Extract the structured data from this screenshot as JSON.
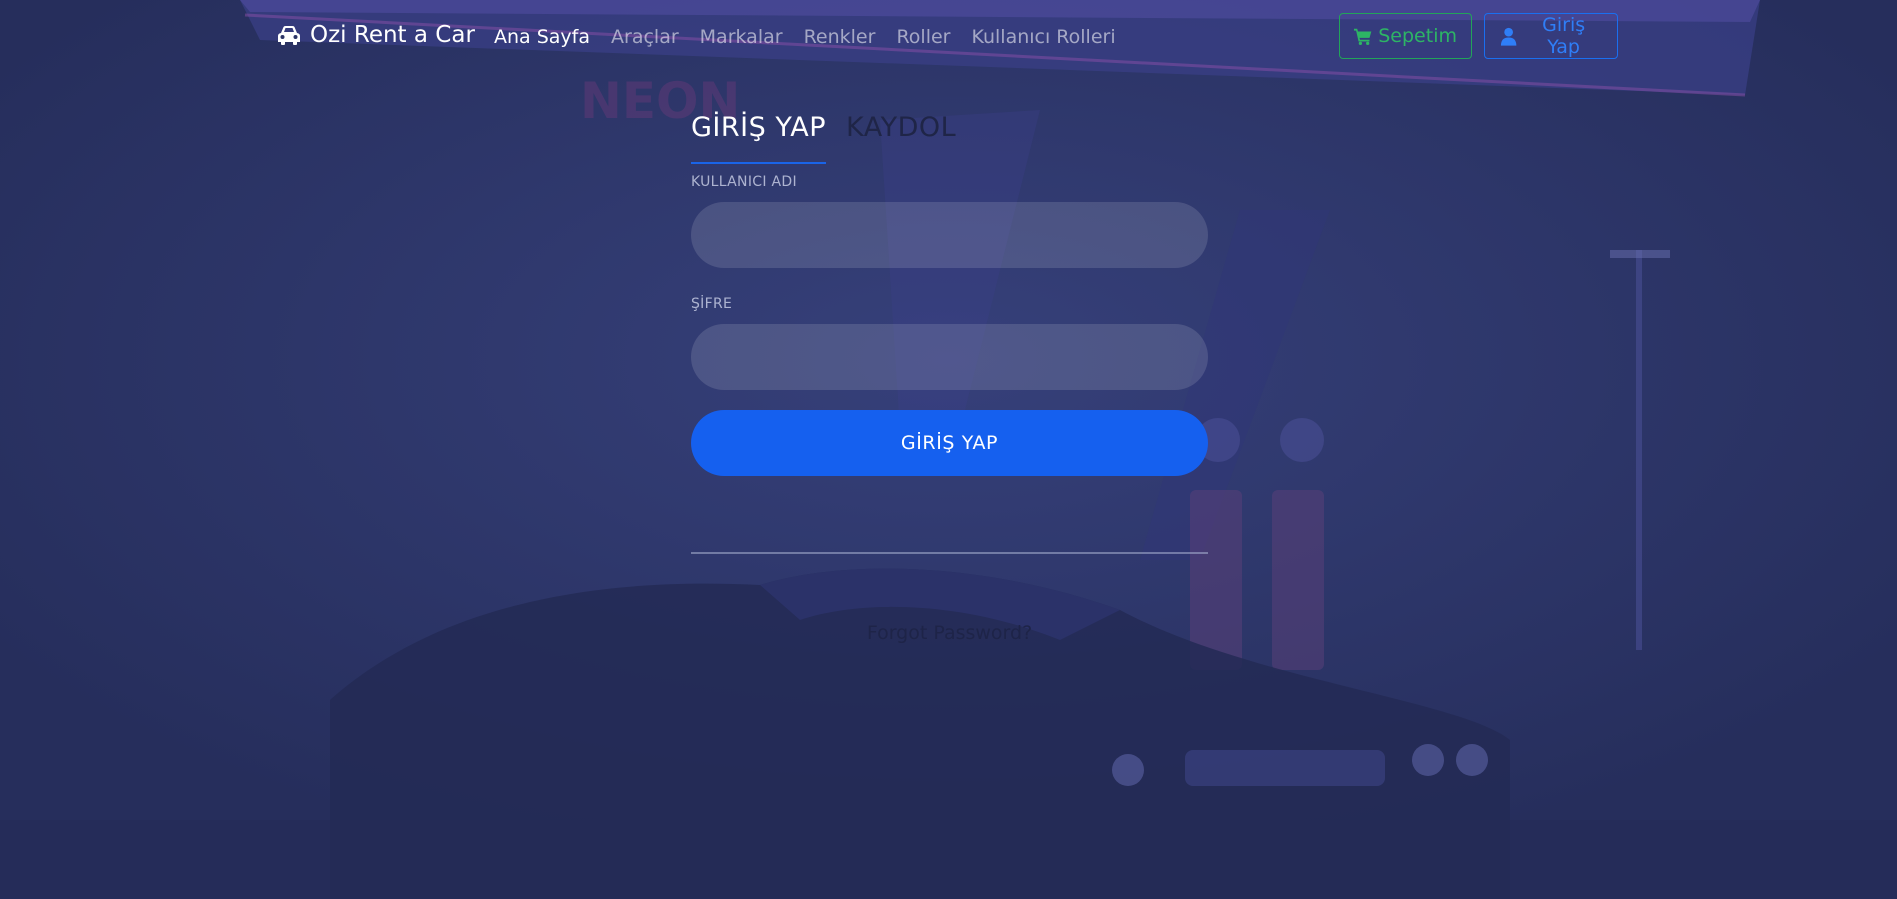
{
  "brand": {
    "name": "Ozi Rent a Car",
    "icon": "car-icon"
  },
  "nav": {
    "links": [
      {
        "label": "Ana Sayfa",
        "active": true
      },
      {
        "label": "Araçlar",
        "active": false
      },
      {
        "label": "Markalar",
        "active": false
      },
      {
        "label": "Renkler",
        "active": false
      },
      {
        "label": "Roller",
        "active": false
      },
      {
        "label": "Kullanıcı Rolleri",
        "active": false
      }
    ],
    "cart_button": {
      "label": "Sepetim",
      "icon": "shopping-cart-icon",
      "color": "#2db565"
    },
    "login_button": {
      "label": "Giriş Yap",
      "icon": "user-icon",
      "color": "#2f7ef7"
    }
  },
  "form": {
    "tabs": [
      {
        "label": "GİRİŞ YAP",
        "active": true
      },
      {
        "label": "KAYDOL",
        "active": false
      }
    ],
    "username": {
      "label": "KULLANICI ADI",
      "value": "",
      "placeholder": ""
    },
    "password": {
      "label": "ŞİFRE",
      "value": "",
      "placeholder": ""
    },
    "submit_label": "GİRİŞ YAP",
    "forgot_password": "Forgot Password?"
  },
  "colors": {
    "accent": "#1560ef",
    "background": "#2b3466",
    "success": "#22a45a"
  }
}
